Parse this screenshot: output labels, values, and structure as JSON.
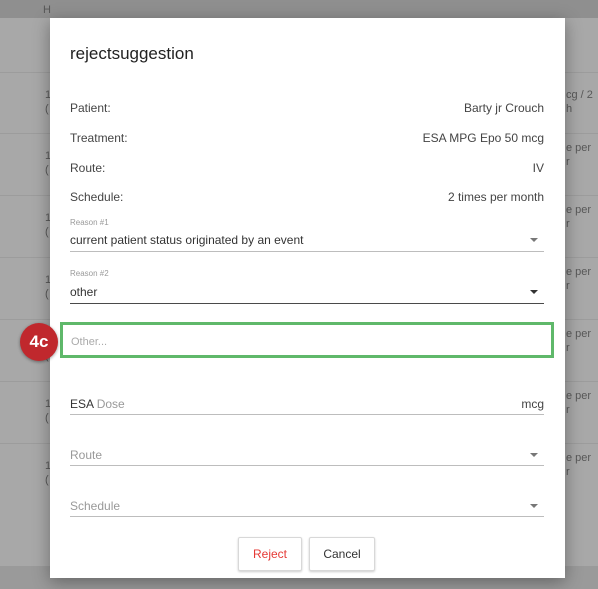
{
  "background": {
    "header_left": "H",
    "rows": [
      {
        "left": "1\n(",
        "right": "cg / 2\nh"
      },
      {
        "left": "1\n(",
        "right": "e per\nr"
      },
      {
        "left": "1\n(",
        "right": "e per\nr"
      },
      {
        "left": "1\n(",
        "right": "e per\nr"
      },
      {
        "left": "1\n(",
        "right": "e per\nr"
      },
      {
        "left": "1\n(",
        "right": "e per\nr"
      },
      {
        "left": "1\n(",
        "right": "e per\nr"
      }
    ]
  },
  "dialog": {
    "title": "rejectsuggestion",
    "info": [
      {
        "label": "Patient:",
        "value": "Barty jr Crouch"
      },
      {
        "label": "Treatment:",
        "value": "ESA MPG Epo 50 mcg"
      },
      {
        "label": "Route:",
        "value": "IV"
      },
      {
        "label": "Schedule:",
        "value": "2 times per month"
      }
    ],
    "reason1": {
      "caption": "Reason #1",
      "value": "current patient status originated by an event"
    },
    "reason2": {
      "caption": "Reason #2",
      "value": "other"
    },
    "other": {
      "placeholder": "Other..."
    },
    "esa_dose": {
      "label_esa": "ESA",
      "label_dose": "Dose",
      "unit": "mcg"
    },
    "route": {
      "placeholder": "Route"
    },
    "schedule": {
      "placeholder": "Schedule"
    },
    "buttons": {
      "reject": "Reject",
      "cancel": "Cancel"
    }
  },
  "annotation": {
    "badge": "4c",
    "highlight_color": "#5fb86a",
    "badge_color": "#c0282d"
  },
  "colors": {
    "reject_text": "#e53935"
  }
}
